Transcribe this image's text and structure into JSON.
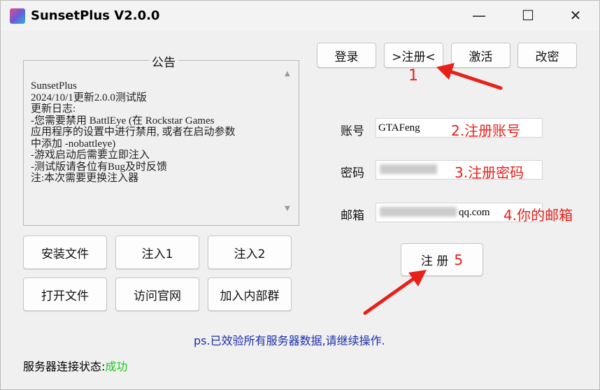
{
  "window": {
    "title": "SunsetPlus V2.0.0",
    "minimize": "—",
    "maximize": "☐",
    "close": "✕"
  },
  "tabs": [
    "登录",
    ">注册<",
    "激活",
    "改密"
  ],
  "notice": {
    "label": "公告",
    "text": "SunsetPlus\n2024/10/1更新2.0.0测试版\n更新日志:\n-您需要禁用 BattlEye (在 Rockstar Games\n应用程序的设置中进行禁用, 或者在启动参数\n中添加 -nobattleye)\n-游戏启动后需要立即注入\n-测试版请各位有Bug及时反馈\n注:本次需要更换注入器"
  },
  "buttons": {
    "install": "安装文件",
    "inject1": "注入1",
    "inject2": "注入2",
    "open_file": "打开文件",
    "visit_site": "访问官网",
    "join_group": "加入内部群"
  },
  "form": {
    "account_label": "账号",
    "account_value": "GTAFeng",
    "password_label": "密码",
    "password_value": "",
    "email_label": "邮箱",
    "email_value": "qq.com",
    "register_button": "注 册"
  },
  "annotations": {
    "step1": "1",
    "step2": "2.注册账号",
    "step3": "3.注册密码",
    "step4": "4.你的邮箱",
    "step5": "5"
  },
  "ps": "ps.已效验所有服务器数据,请继续操作.",
  "status": {
    "label": "服务器连接状态:",
    "value": "成功",
    "value_color": "#19c819"
  }
}
